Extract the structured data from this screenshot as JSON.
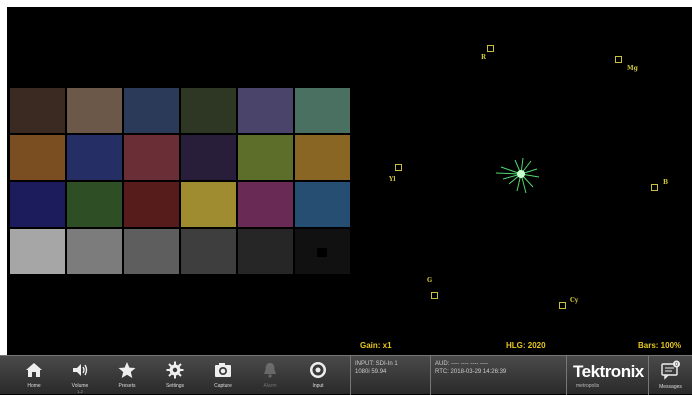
{
  "video": {
    "colors": [
      "#3a2a22",
      "#6b5848",
      "#2c3a5a",
      "#2e3624",
      "#4a446a",
      "#4a7062",
      "#7a4e20",
      "#262e66",
      "#6a2e36",
      "#281e3a",
      "#5c6e2a",
      "#8a6624",
      "#1c1c5c",
      "#2e4e26",
      "#561c1c",
      "#a08c30",
      "#6a2a56",
      "#264e72",
      "#a6a6a6",
      "#7c7c7c",
      "#5e5e5e",
      "#3e3e3e",
      "#262626",
      "#111111"
    ]
  },
  "vectorscope": {
    "targets": [
      {
        "label": "R"
      },
      {
        "label": "Mg"
      },
      {
        "label": "Yl"
      },
      {
        "label": "B"
      },
      {
        "label": "G"
      },
      {
        "label": "Cy"
      }
    ]
  },
  "readouts": {
    "gain": "Gain: x1",
    "hlg": "HLG: 2020",
    "bars": "Bars: 100%"
  },
  "toolbar": {
    "home": "Home",
    "volume": "Volume",
    "volume_sub": "1-2",
    "presets": "Presets",
    "settings": "Settings",
    "capture": "Capture",
    "alarm": "Alarm",
    "input": "Input",
    "messages": "Messages",
    "messages_count": "0"
  },
  "status": {
    "input_line1": "INPUT: SDI-In 1",
    "input_line2": "1080i 59.94",
    "aud_line": "AUD: ---- ---- ---- ----",
    "rtc_line": "RTC: 2018-03-29 14:26:39"
  },
  "brand": {
    "name": "Tektronix",
    "sub": "metropolis"
  }
}
